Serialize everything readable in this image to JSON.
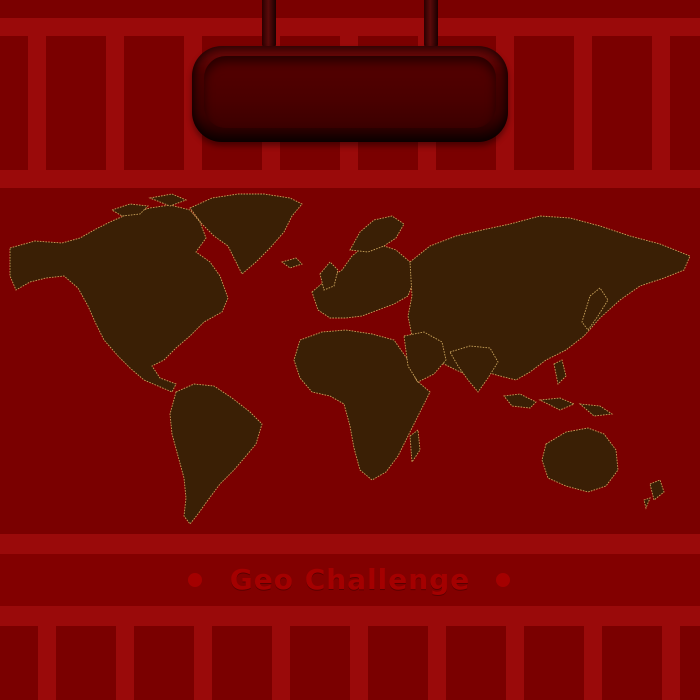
{
  "title": "Geo Challenge",
  "colors": {
    "background": "#7a0000",
    "rail": "#9a0a0a",
    "land": "#3a1f05",
    "border_line": "#c9a25a",
    "title": "#a40000"
  },
  "map": {
    "kind": "world-map"
  }
}
